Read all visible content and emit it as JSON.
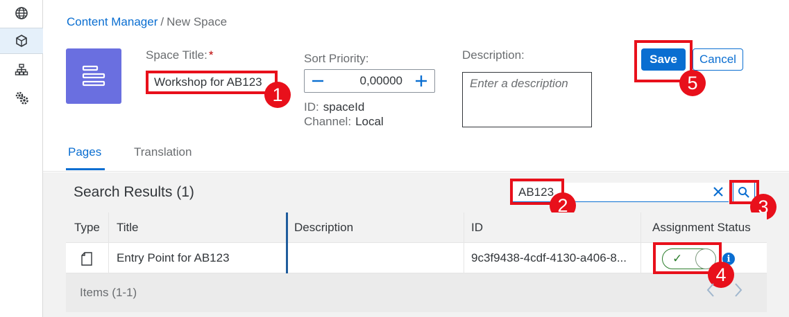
{
  "sidebar": {
    "items": [
      {
        "icon": "globe-icon"
      },
      {
        "icon": "cube-icon",
        "active": true
      },
      {
        "icon": "hierarchy-icon"
      },
      {
        "icon": "settings-icon"
      }
    ]
  },
  "breadcrumb": {
    "link": "Content Manager",
    "separator": "/",
    "current": "New Space"
  },
  "form": {
    "space_title_label": "Space Title:",
    "required_mark": "*",
    "space_title_value": "Workshop for AB123",
    "sort_priority_label": "Sort Priority:",
    "sort_priority_value": "0,00000",
    "id_label": "ID:",
    "id_value": "spaceId",
    "channel_label": "Channel:",
    "channel_value": "Local",
    "description_label": "Description:",
    "description_placeholder": "Enter a description"
  },
  "actions": {
    "save_label": "Save",
    "cancel_label": "Cancel"
  },
  "tabs": [
    {
      "label": "Pages",
      "active": true
    },
    {
      "label": "Translation",
      "active": false
    }
  ],
  "results": {
    "title": "Search Results (1)",
    "search_value": "AB123",
    "columns": [
      "Type",
      "Title",
      "Description",
      "ID",
      "Assignment Status"
    ],
    "rows": [
      {
        "type_icon": "page-icon",
        "title": "Entry Point for AB123",
        "description": "",
        "id": "9c3f9438-4cdf-4130-a406-8...",
        "assigned": true
      }
    ],
    "items_label": "Items (1-1)"
  },
  "markers": [
    "1",
    "2",
    "3",
    "4",
    "5"
  ],
  "colors": {
    "accent": "#0a6ed1",
    "highlight": "#e8101b",
    "space_icon_bg": "#6a6fe0",
    "switch_on": "#2b7d2b"
  }
}
